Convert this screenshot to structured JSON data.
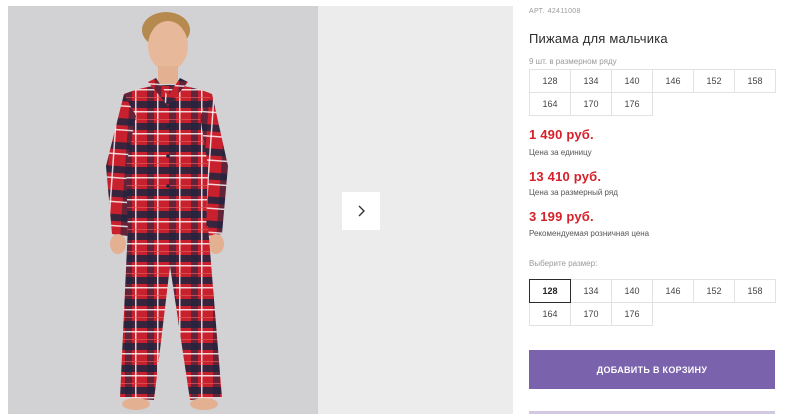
{
  "product": {
    "art_label": "АРТ.",
    "art_number": "42411008",
    "title": "Пижама для мальчика"
  },
  "row_note": "9 шт. в размерном ряду",
  "size_row": [
    "128",
    "134",
    "140",
    "146",
    "152",
    "158",
    "164",
    "170",
    "176"
  ],
  "prices": {
    "unit_price": "1 490 руб.",
    "unit_label": "Цена за единицу",
    "row_price": "13 410 руб.",
    "row_label": "Цена за размерный ряд",
    "retail_price": "3 199 руб.",
    "retail_label": "Рекомендуемая розничная цена"
  },
  "choose_size": {
    "label": "Выберите размер:",
    "options": [
      "128",
      "134",
      "140",
      "146",
      "152",
      "158",
      "164",
      "170",
      "176"
    ],
    "selected": "128"
  },
  "add_to_cart": "ДОБАВИТЬ В КОРЗИНУ",
  "gallery": {
    "next_icon": "chevron-right-icon",
    "photo_subject": "boy-in-plaid-pajamas"
  },
  "colors": {
    "price_red": "#d6202a",
    "button_purple": "#7a62ad",
    "plaid_red": "#c8202c",
    "plaid_navy": "#1f2440"
  }
}
